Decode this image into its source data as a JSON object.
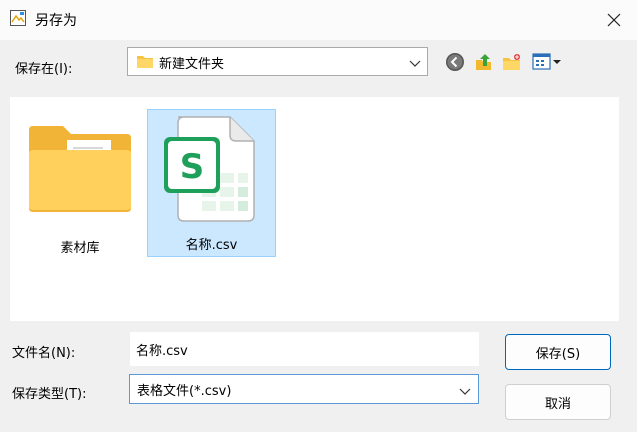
{
  "window": {
    "title": "另存为",
    "title_icon": "save-as-document-icon",
    "close_icon": "close-icon"
  },
  "location": {
    "label": "保存在(I):",
    "current_folder": "新建文件夹",
    "folder_icon": "folder-icon"
  },
  "toolbar": {
    "back_icon": "back-arrow-icon",
    "up_icon": "up-folder-icon",
    "new_folder_icon": "new-folder-icon",
    "view_menu_icon": "view-menu-icon"
  },
  "files": [
    {
      "name": "素材库",
      "type": "folder",
      "icon": "folder-icon",
      "selected": false
    },
    {
      "name": "名称.csv",
      "type": "csv",
      "icon": "spreadsheet-s-icon",
      "selected": true
    }
  ],
  "form": {
    "filename_label": "文件名(N):",
    "filename_value": "名称.csv",
    "filetype_label": "保存类型(T):",
    "filetype_value": "表格文件(*.csv)"
  },
  "buttons": {
    "save": "保存(S)",
    "cancel": "取消"
  },
  "colors": {
    "selection_bg": "#cce8ff",
    "selection_border": "#99d1ff",
    "primary_border": "#0067c0",
    "spreadsheet_green": "#1e9f5a"
  }
}
